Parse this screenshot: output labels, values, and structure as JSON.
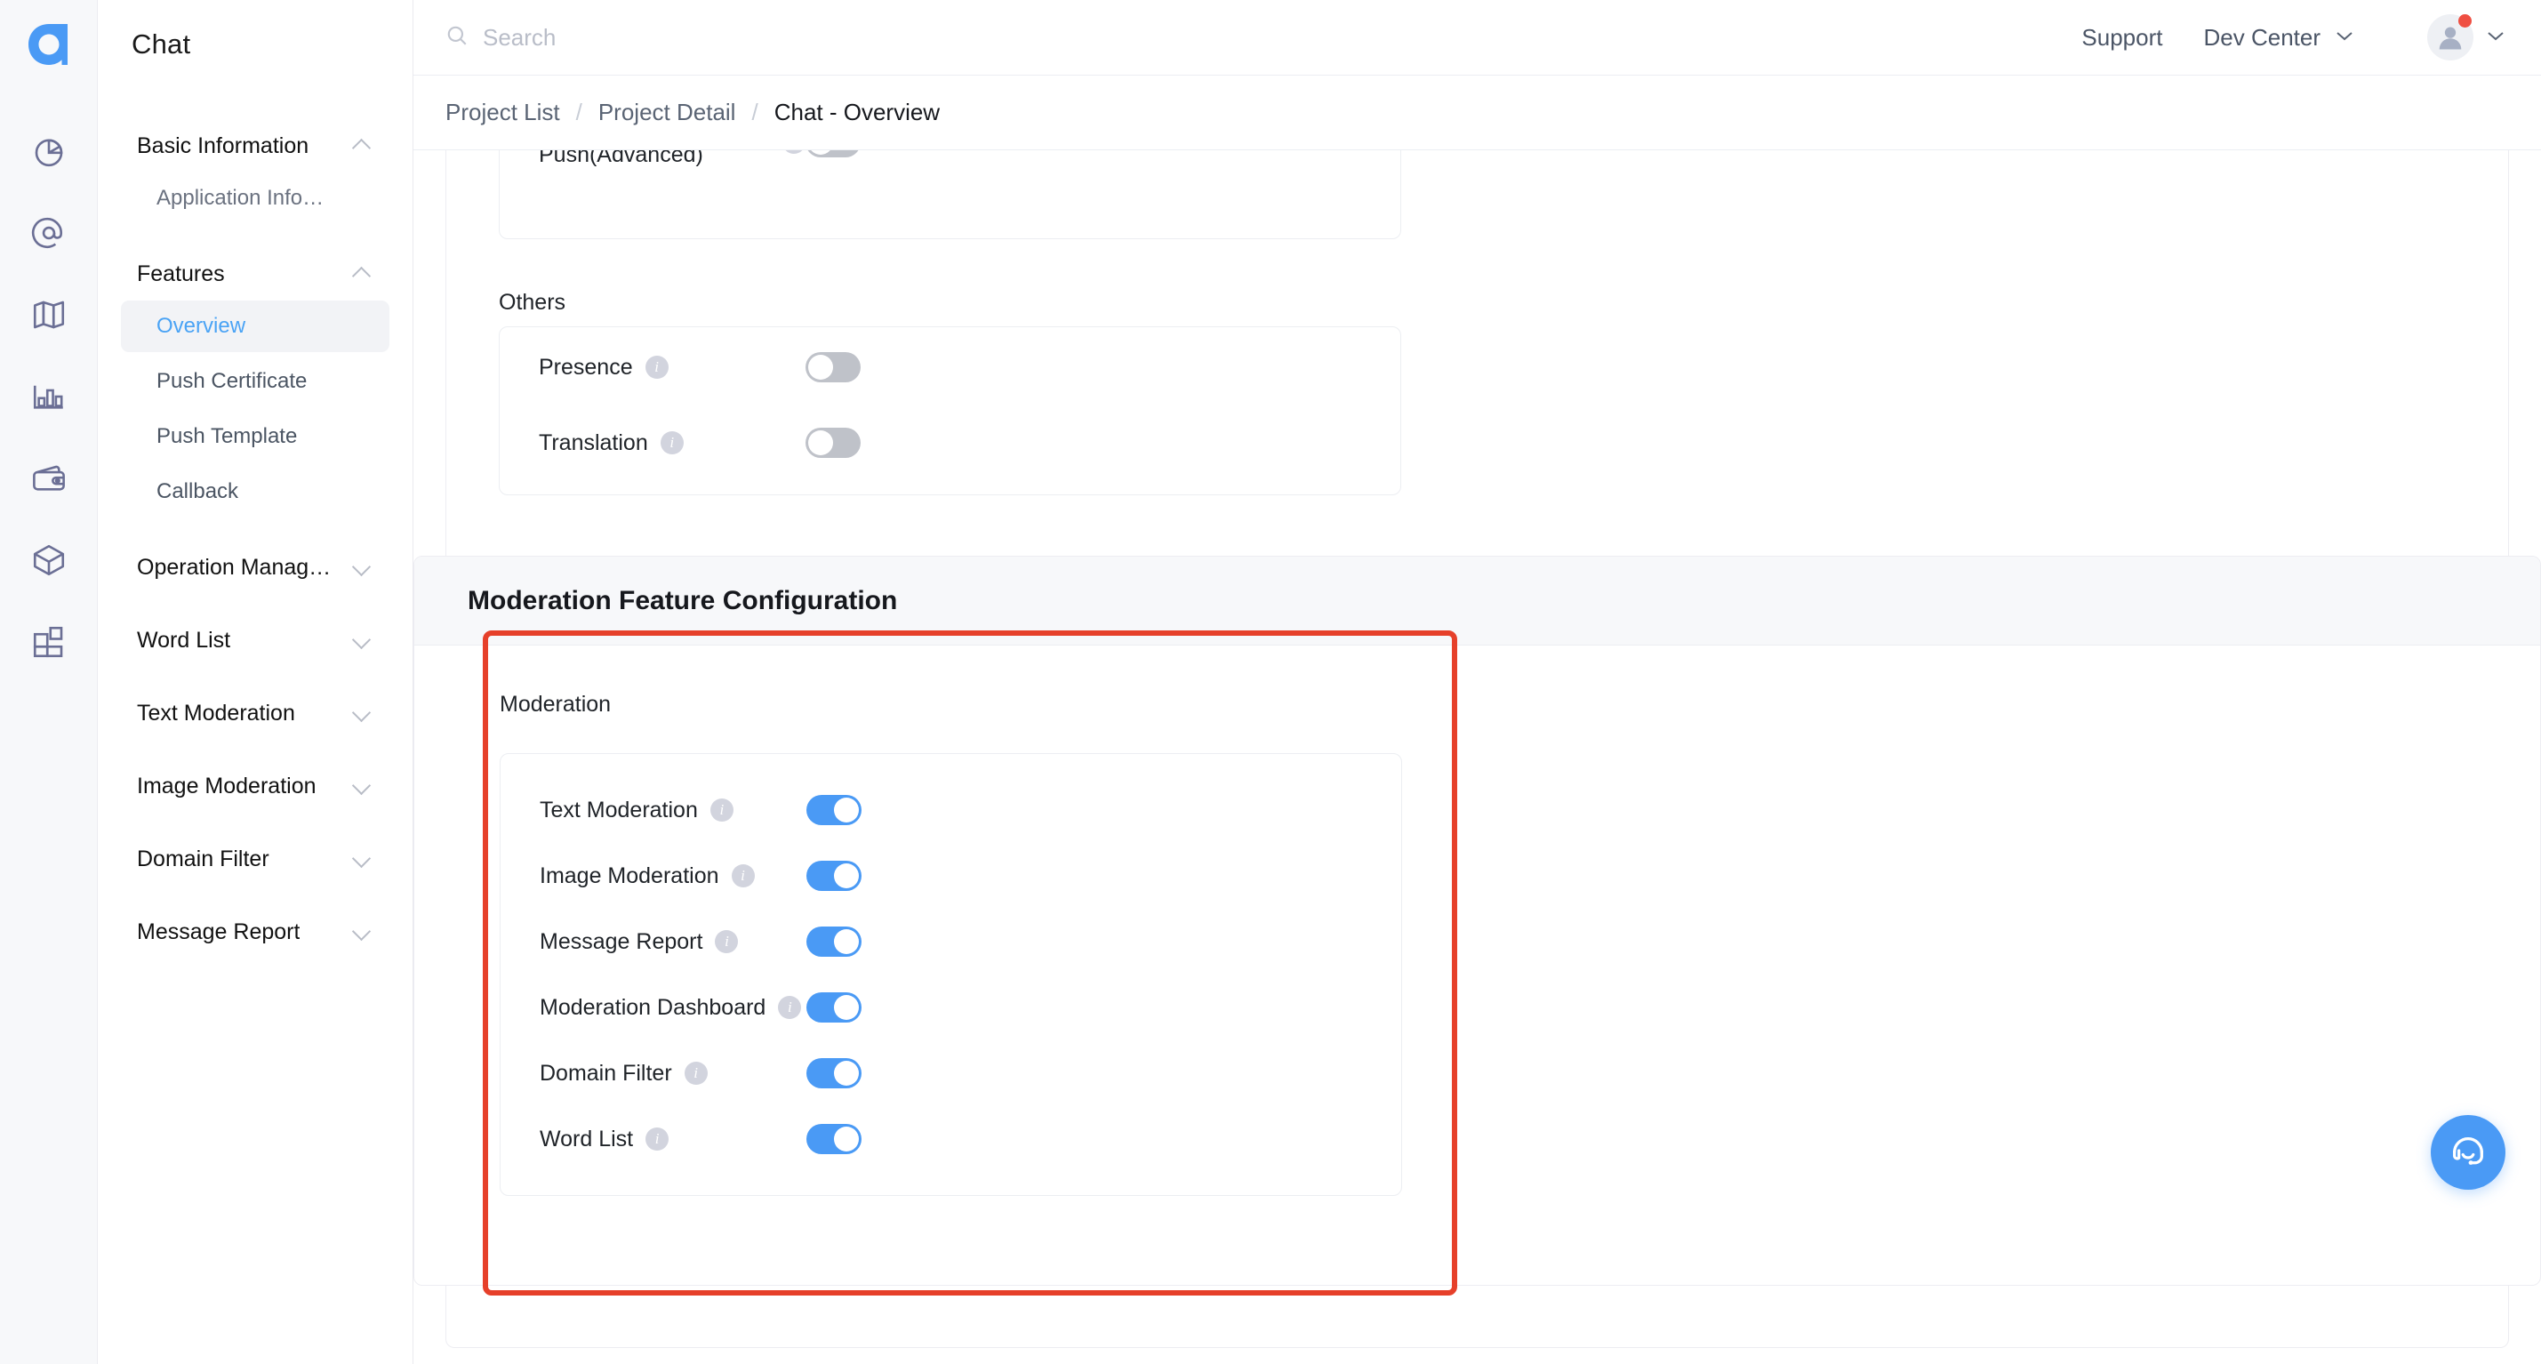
{
  "brand": {
    "logo_letter": "a",
    "accent": "#4a9af5",
    "highlight": "#e6402a"
  },
  "rail": {
    "items": [
      {
        "icon": "pie-chart-icon"
      },
      {
        "icon": "at-mention-icon"
      },
      {
        "icon": "map-icon"
      },
      {
        "icon": "bar-chart-icon"
      },
      {
        "icon": "wallet-icon"
      },
      {
        "icon": "package-box-icon"
      },
      {
        "icon": "apps-grid-icon"
      }
    ]
  },
  "sidebar": {
    "title": "Chat",
    "groups": [
      {
        "label": "Basic Information",
        "expanded": true,
        "items": [
          {
            "label": "Application Info…",
            "active": false
          }
        ]
      },
      {
        "label": "Features",
        "expanded": true,
        "items": [
          {
            "label": "Overview",
            "active": true
          },
          {
            "label": "Push Certificate",
            "active": false
          },
          {
            "label": "Push Template",
            "active": false
          },
          {
            "label": "Callback",
            "active": false
          }
        ]
      },
      {
        "label": "Operation Manag…",
        "expanded": false,
        "items": []
      },
      {
        "label": "Word List",
        "expanded": false,
        "items": []
      },
      {
        "label": "Text Moderation",
        "expanded": false,
        "items": []
      },
      {
        "label": "Image Moderation",
        "expanded": false,
        "items": []
      },
      {
        "label": "Domain Filter",
        "expanded": false,
        "items": []
      },
      {
        "label": "Message Report",
        "expanded": false,
        "items": []
      }
    ]
  },
  "topbar": {
    "search_placeholder": "Search",
    "support_label": "Support",
    "dev_center_label": "Dev Center",
    "search_icon": "search-icon",
    "avatar_icon": "user-avatar-icon",
    "has_notification": true
  },
  "breadcrumb": {
    "items": [
      "Project List",
      "Project Detail"
    ],
    "separator": "/",
    "current": "Chat - Overview"
  },
  "content": {
    "push_row": {
      "label": "Offline Message Push(Advanced)",
      "enabled": false
    },
    "others_caption": "Others",
    "others_rows": [
      {
        "label": "Presence",
        "enabled": false
      },
      {
        "label": "Translation",
        "enabled": false
      }
    ]
  },
  "moderation_card": {
    "title": "Moderation Feature Configuration",
    "caption": "Moderation",
    "rows": [
      {
        "label": "Text Moderation",
        "enabled": true
      },
      {
        "label": "Image Moderation",
        "enabled": true
      },
      {
        "label": "Message Report",
        "enabled": true
      },
      {
        "label": "Moderation Dashboard",
        "enabled": true
      },
      {
        "label": "Domain Filter",
        "enabled": true
      },
      {
        "label": "Word List",
        "enabled": true
      }
    ]
  },
  "fab": {
    "icon": "headset-support-icon"
  }
}
